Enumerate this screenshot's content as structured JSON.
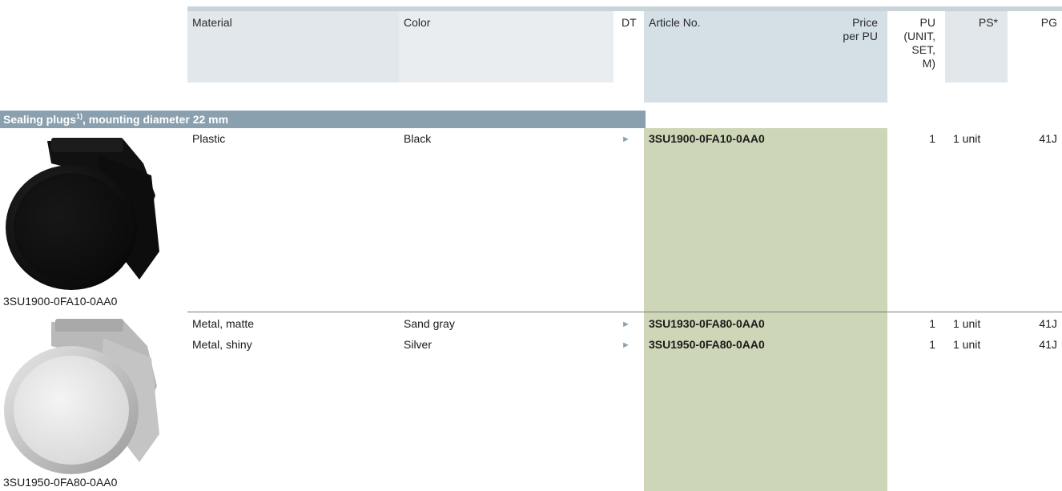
{
  "header": {
    "material": "Material",
    "color": "Color",
    "dt": "DT",
    "article_no": "Article No.",
    "price_line1": "Price",
    "price_line2": "per PU",
    "pu_line1": "PU",
    "pu_line2": "(UNIT,",
    "pu_line3": "SET,",
    "pu_line4": "M)",
    "ps": "PS*",
    "pg": "PG"
  },
  "section": {
    "title_part1": "Sealing plugs",
    "footnote": "1)",
    "title_part2": ", mounting diameter 22 mm"
  },
  "products": [
    {
      "image_caption": "3SU1900-0FA10-0AA0",
      "image_icon": "black-sealing-plug-image",
      "rows": [
        {
          "material": "Plastic",
          "color": "Black",
          "dt": "►",
          "article": "3SU1900-0FA10-0AA0",
          "pu": "1",
          "ps": "1 unit",
          "pg": "41J"
        }
      ]
    },
    {
      "image_caption": "3SU1950-0FA80-0AA0",
      "image_icon": "silver-sealing-plug-image",
      "rows": [
        {
          "material": "Metal, matte",
          "color": "Sand gray",
          "dt": "►",
          "article": "3SU1930-0FA80-0AA0",
          "pu": "1",
          "ps": "1 unit",
          "pg": "41J"
        },
        {
          "material": "Metal, shiny",
          "color": "Silver",
          "dt": "►",
          "article": "3SU1950-0FA80-0AA0",
          "pu": "1",
          "ps": "1 unit",
          "pg": "41J"
        }
      ]
    }
  ],
  "colors": {
    "header_bg": "#e2e7eb",
    "article_header_bg": "#d4dfe6",
    "section_bar": "#8aa0ae",
    "article_column_bg": "#cdd6b7"
  }
}
